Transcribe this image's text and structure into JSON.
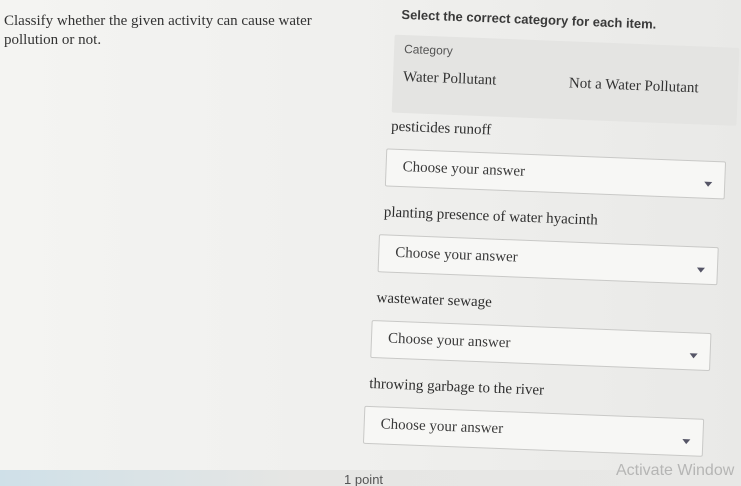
{
  "question": {
    "text": "Classify whether the given activity can cause water pollution or not."
  },
  "instruction": "Select the correct category for each item.",
  "category": {
    "header": "Category",
    "options": [
      "Water Pollutant",
      "Not a Water Pollutant"
    ]
  },
  "items": [
    {
      "label": "pesticides runoff",
      "placeholder": "Choose your answer"
    },
    {
      "label": "planting presence of water hyacinth",
      "placeholder": "Choose your answer"
    },
    {
      "label": "wastewater sewage",
      "placeholder": "Choose your answer"
    },
    {
      "label": "throwing garbage to the river",
      "placeholder": "Choose your answer"
    }
  ],
  "footer": {
    "points": "1 point"
  },
  "watermark": "Activate Window"
}
